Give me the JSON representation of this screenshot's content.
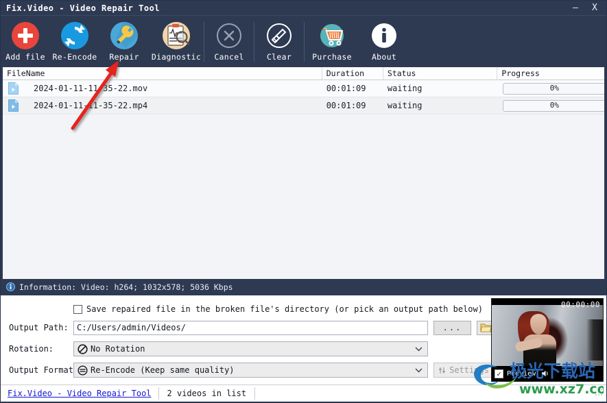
{
  "window": {
    "title": "Fix.Video - Video Repair Tool",
    "minimize_label": "–",
    "close_label": "X"
  },
  "toolbar": {
    "items": [
      {
        "label": "Add file",
        "icon": "plus-circle-icon"
      },
      {
        "label": "Re-Encode",
        "icon": "refresh-circle-icon"
      },
      {
        "label": "Repair",
        "icon": "wrench-screwdriver-icon"
      },
      {
        "label": "Diagnostic",
        "icon": "clipboard-magnifier-icon"
      },
      {
        "label": "Cancel",
        "icon": "cancel-circle-icon"
      },
      {
        "label": "Clear",
        "icon": "broom-circle-icon"
      },
      {
        "label": "Purchase",
        "icon": "shopping-cart-icon"
      },
      {
        "label": "About",
        "icon": "info-circle-icon"
      }
    ]
  },
  "file_list": {
    "columns": [
      "FileName",
      "Duration",
      "Status",
      "Progress"
    ],
    "rows": [
      {
        "filename": "2024-01-11-11-35-22.mov",
        "duration": "00:01:09",
        "status": "waiting",
        "progress": "0%"
      },
      {
        "filename": "2024-01-11-11-35-22.mp4",
        "duration": "00:01:09",
        "status": "waiting",
        "progress": "0%"
      }
    ]
  },
  "information": {
    "text": "Information: Video: h264; 1032x578; 5036 Kbps"
  },
  "options": {
    "save_in_broken_dir_label": "Save repaired file in the broken file's directory (or pick an output path below)",
    "save_in_broken_dir_checked": false,
    "output_path_label": "Output Path:",
    "output_path_value": "C:/Users/admin/Videos/",
    "browse_dots_label": "...",
    "folder_button_icon": "folder-icon",
    "rotation_label": "Rotation:",
    "rotation_value": "No Rotation",
    "output_format_label": "Output Format:",
    "output_format_value": "Re-Encode (Keep same quality)",
    "settings_label": "Settings"
  },
  "preview": {
    "timecode": "00:00:00",
    "checkbox_label": "Preview",
    "checkbox_checked": true,
    "speaker_icon": "speaker-icon"
  },
  "status_bar": {
    "link_label": "Fix.Video - Video Repair Tool",
    "count_label": "2 videos in list"
  },
  "watermark": {
    "site_cn": "极光下载站",
    "site_url": "www.xz7.com"
  },
  "colors": {
    "chrome": "#2e3a52",
    "list_bg": "#f2f4f8",
    "accent_red": "#e8453c",
    "accent_blue": "#1e9cf0",
    "link_blue": "#1414d6",
    "arrow_red": "#e8201a"
  }
}
